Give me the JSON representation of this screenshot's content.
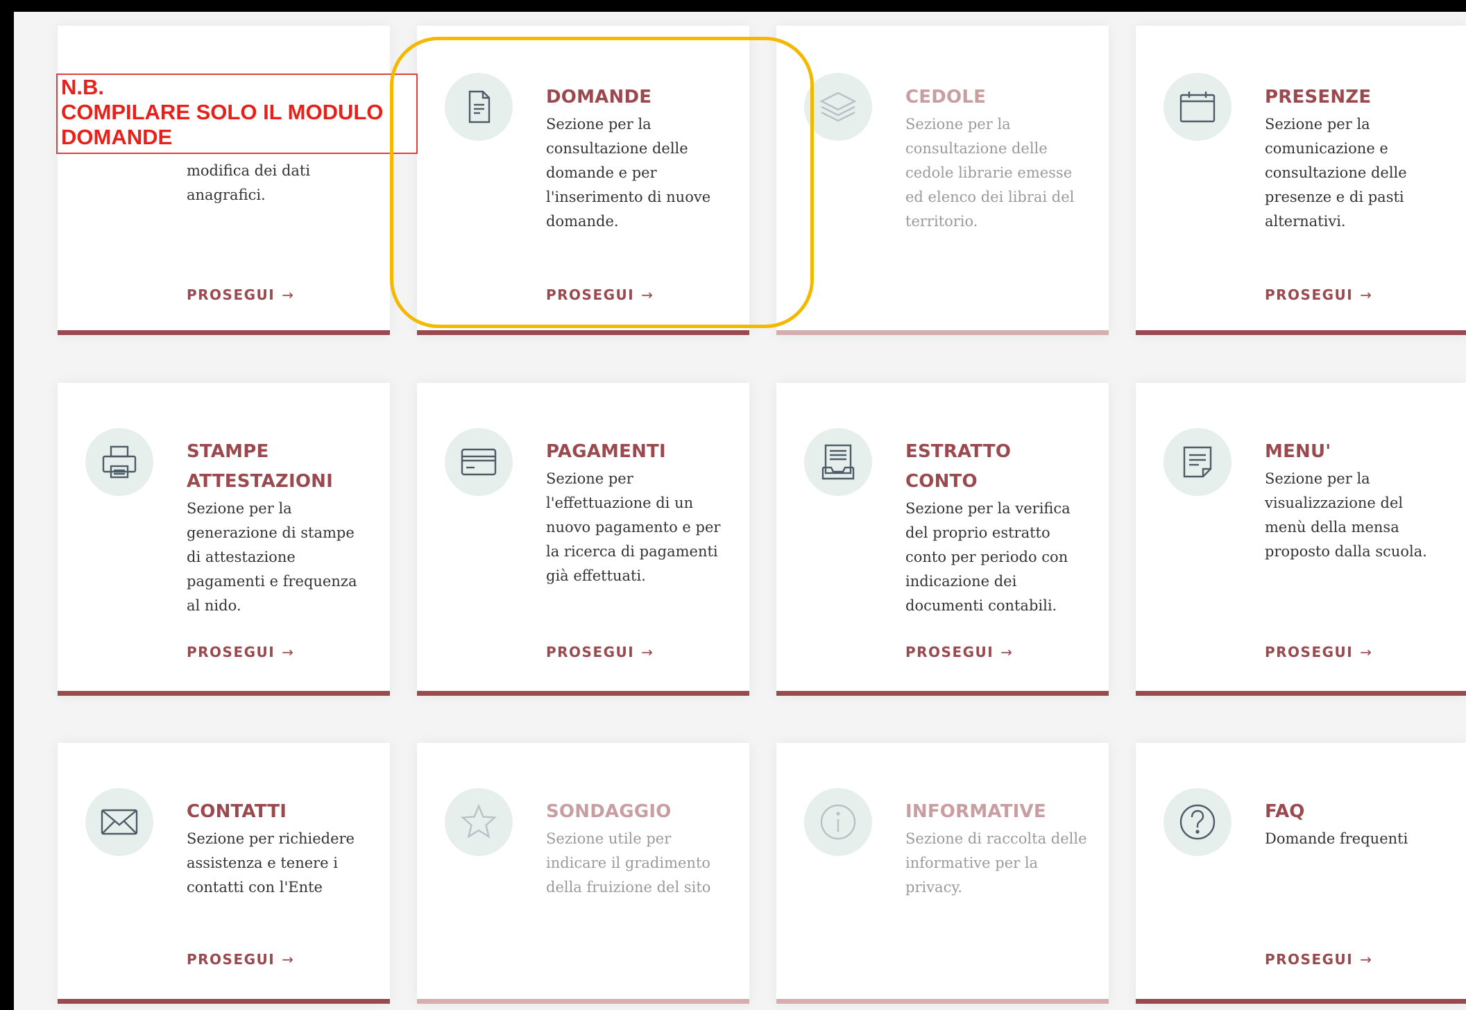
{
  "note": {
    "lines": [
      "N.B.",
      "COMPILARE SOLO IL MODULO",
      "DOMANDE"
    ]
  },
  "colors": {
    "accent": "#9a4a4e",
    "accent_disabled": "#c89ea0",
    "icon_bg": "#e6efec",
    "note_red": "#e8201a",
    "highlight": "#f5b800"
  },
  "cards": [
    {
      "key": "anagrafica",
      "title": "",
      "description": "modifica dei dati anagrafici.",
      "action": "PROSEGUI",
      "icon": "none",
      "enabled": true
    },
    {
      "key": "domande",
      "title": "DOMANDE",
      "description": "Sezione per la consultazione delle domande e per l'inserimento di nuove domande.",
      "action": "PROSEGUI",
      "icon": "document-icon",
      "enabled": true
    },
    {
      "key": "cedole",
      "title": "CEDOLE",
      "description": "Sezione per la consultazione delle cedole librarie emesse ed elenco dei librai del territorio.",
      "action": "",
      "icon": "layers-icon",
      "enabled": false
    },
    {
      "key": "presenze",
      "title": "PRESENZE",
      "description": "Sezione per la comunicazione e consultazione delle presenze e di pasti alternativi.",
      "action": "PROSEGUI",
      "icon": "calendar-icon",
      "enabled": true
    },
    {
      "key": "stampe",
      "title": "STAMPE ATTESTAZIONI",
      "description": "Sezione per la generazione di stampe di attestazione pagamenti e frequenza al nido.",
      "action": "PROSEGUI",
      "icon": "printer-icon",
      "enabled": true
    },
    {
      "key": "pagamenti",
      "title": "PAGAMENTI",
      "description": "Sezione per l'effettuazione di un nuovo pagamento e per la ricerca di pagamenti già effettuati.",
      "action": "PROSEGUI",
      "icon": "credit-card-icon",
      "enabled": true
    },
    {
      "key": "estratto",
      "title": "ESTRATTO CONTO",
      "description": "Sezione per la verifica del proprio estratto conto per periodo con indicazione dei documenti contabili.",
      "action": "PROSEGUI",
      "icon": "inbox-icon",
      "enabled": true
    },
    {
      "key": "menu",
      "title": "MENU'",
      "description": "Sezione per la visualizzazione del menù della mensa proposto dalla scuola.",
      "action": "PROSEGUI",
      "icon": "note-icon",
      "enabled": true
    },
    {
      "key": "contatti",
      "title": "CONTATTI",
      "description": "Sezione per richiedere assistenza e tenere i contatti con l'Ente",
      "action": "PROSEGUI",
      "icon": "envelope-icon",
      "enabled": true
    },
    {
      "key": "sondaggio",
      "title": "SONDAGGIO",
      "description": "Sezione utile per indicare il gradimento della fruizione del sito",
      "action": "",
      "icon": "star-icon",
      "enabled": false
    },
    {
      "key": "informative",
      "title": "INFORMATIVE",
      "description": "Sezione di raccolta delle informative per la privacy.",
      "action": "",
      "icon": "info-icon",
      "enabled": false
    },
    {
      "key": "faq",
      "title": "FAQ",
      "description": "Domande frequenti",
      "action": "PROSEGUI",
      "icon": "question-icon",
      "enabled": true
    }
  ]
}
